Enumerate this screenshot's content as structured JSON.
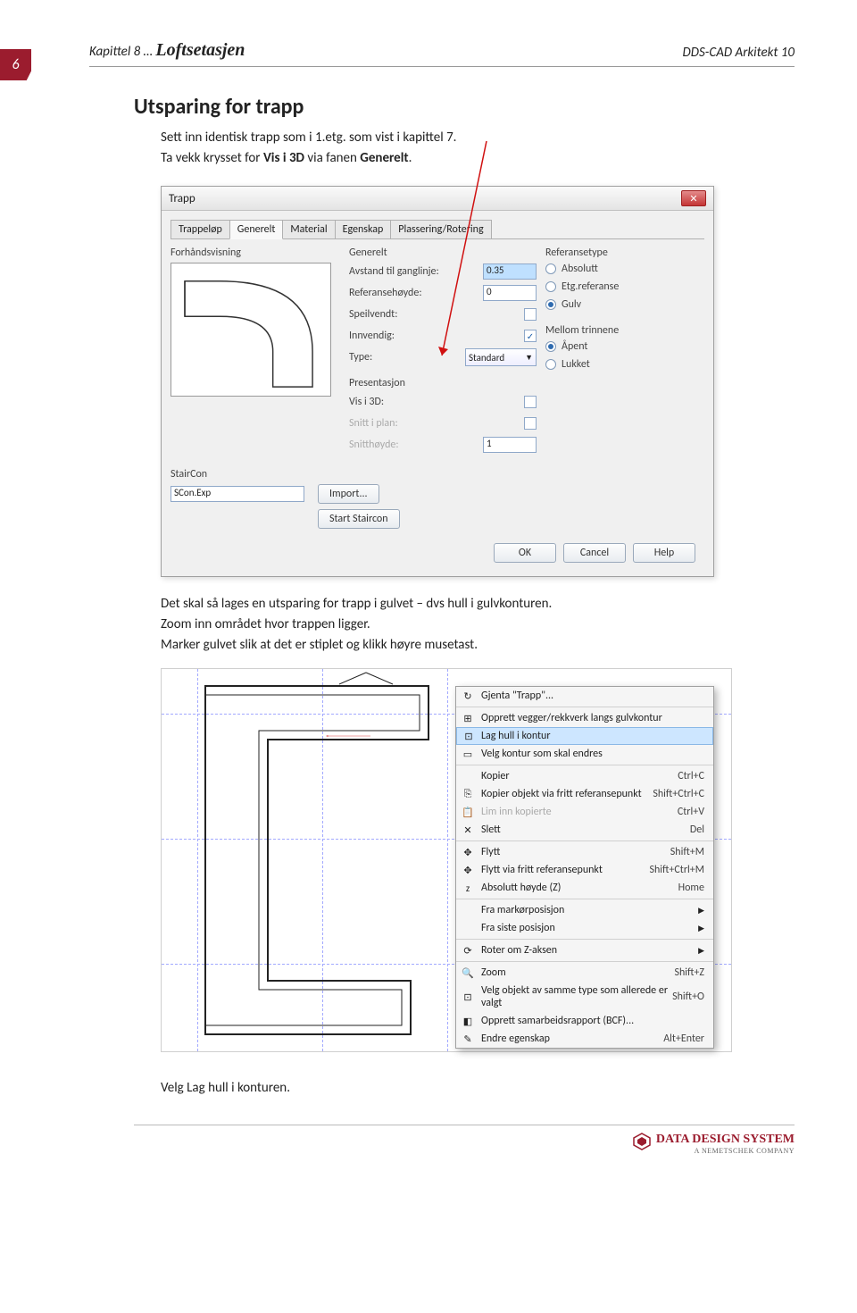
{
  "page_number": "6",
  "header": {
    "left_pre": "Kapittel 8 … ",
    "left_bold": "Loftsetasjen",
    "right": "DDS-CAD Arkitekt 10"
  },
  "section": {
    "title": "Utsparing for trapp",
    "p1": "Sett inn identisk trapp som i 1.etg. som vist i kapittel 7.",
    "p2a": "Ta vekk krysset for ",
    "p2b": "Vis i 3D",
    "p2c": " via fanen ",
    "p2d": "Generelt",
    "p2e": "."
  },
  "dialog": {
    "title": "Trapp",
    "tabs": [
      "Trappeløp",
      "Generelt",
      "Material",
      "Egenskap",
      "Plassering/Rotering"
    ],
    "preview_label": "Forhåndsvisning",
    "generelt": {
      "label": "Generelt",
      "avstand_label": "Avstand til ganglinje:",
      "avstand_value": "0.35",
      "ref_label": "Referansehøyde:",
      "ref_value": "0",
      "speil_label": "Speilvendt:",
      "innv_label": "Innvendig:",
      "type_label": "Type:",
      "type_value": "Standard"
    },
    "presentasjon": {
      "label": "Presentasjon",
      "vis3d_label": "Vis i 3D:",
      "snitt_label": "Snitt i plan:",
      "snitth_label": "Snitthøyde:",
      "snitth_value": "1"
    },
    "referansetype": {
      "label": "Referansetype",
      "abs": "Absolutt",
      "etg": "Etg.referanse",
      "gulv": "Gulv"
    },
    "mellom": {
      "label": "Mellom trinnene",
      "apent": "Åpent",
      "lukket": "Lukket"
    },
    "staircon": {
      "label": "StairCon",
      "file": "SCon.Exp",
      "import": "Import...",
      "start": "Start Staircon"
    },
    "buttons": {
      "ok": "OK",
      "cancel": "Cancel",
      "help": "Help"
    }
  },
  "mid_text": {
    "p1": "Det skal så lages en utsparing for trapp i gulvet – dvs hull i gulvkonturen.",
    "p2": "Zoom inn området hvor trappen ligger.",
    "p3": "Marker gulvet slik at det er stiplet og klikk høyre musetast."
  },
  "context_menu": {
    "items": [
      {
        "label": "Gjenta \"Trapp\"...",
        "icon": "↻"
      },
      {
        "sep": true
      },
      {
        "label": "Opprett vegger/rekkverk langs gulvkontur",
        "icon": "⊞"
      },
      {
        "label": "Lag hull i kontur",
        "icon": "⊡",
        "hl": true
      },
      {
        "label": "Velg kontur som skal endres",
        "icon": "▭"
      },
      {
        "sep": true
      },
      {
        "label": "Kopier",
        "shortcut": "Ctrl+C"
      },
      {
        "label": "Kopier objekt via fritt referansepunkt",
        "icon": "⎘",
        "shortcut": "Shift+Ctrl+C"
      },
      {
        "label": "Lim inn kopierte",
        "icon": "📋",
        "shortcut": "Ctrl+V",
        "disabled": true
      },
      {
        "label": "Slett",
        "icon": "✕",
        "shortcut": "Del"
      },
      {
        "sep": true
      },
      {
        "label": "Flytt",
        "icon": "✥",
        "shortcut": "Shift+M"
      },
      {
        "label": "Flytt via fritt referansepunkt",
        "icon": "✥",
        "shortcut": "Shift+Ctrl+M"
      },
      {
        "label": "Absolutt høyde (Z)",
        "icon": "z",
        "shortcut": "Home"
      },
      {
        "sep": true
      },
      {
        "label": "Fra markørposisjon",
        "submenu": true
      },
      {
        "label": "Fra siste posisjon",
        "submenu": true
      },
      {
        "sep": true
      },
      {
        "label": "Roter om Z-aksen",
        "icon": "⟳",
        "submenu": true
      },
      {
        "sep": true
      },
      {
        "label": "Zoom",
        "icon": "🔍",
        "shortcut": "Shift+Z"
      },
      {
        "label": "Velg objekt av samme type som allerede er valgt",
        "icon": "⊡",
        "shortcut": "Shift+O"
      },
      {
        "label": "Opprett samarbeidsrapport (BCF)...",
        "icon": "◧"
      },
      {
        "label": "Endre egenskap",
        "icon": "✎",
        "shortcut": "Alt+Enter"
      }
    ]
  },
  "final": {
    "pre": "Velg ",
    "bold": "Lag hull i konturen",
    "post": "."
  },
  "footer": {
    "company": "DATA DESIGN SYSTEM",
    "sub": "A NEMETSCHEK COMPANY"
  }
}
